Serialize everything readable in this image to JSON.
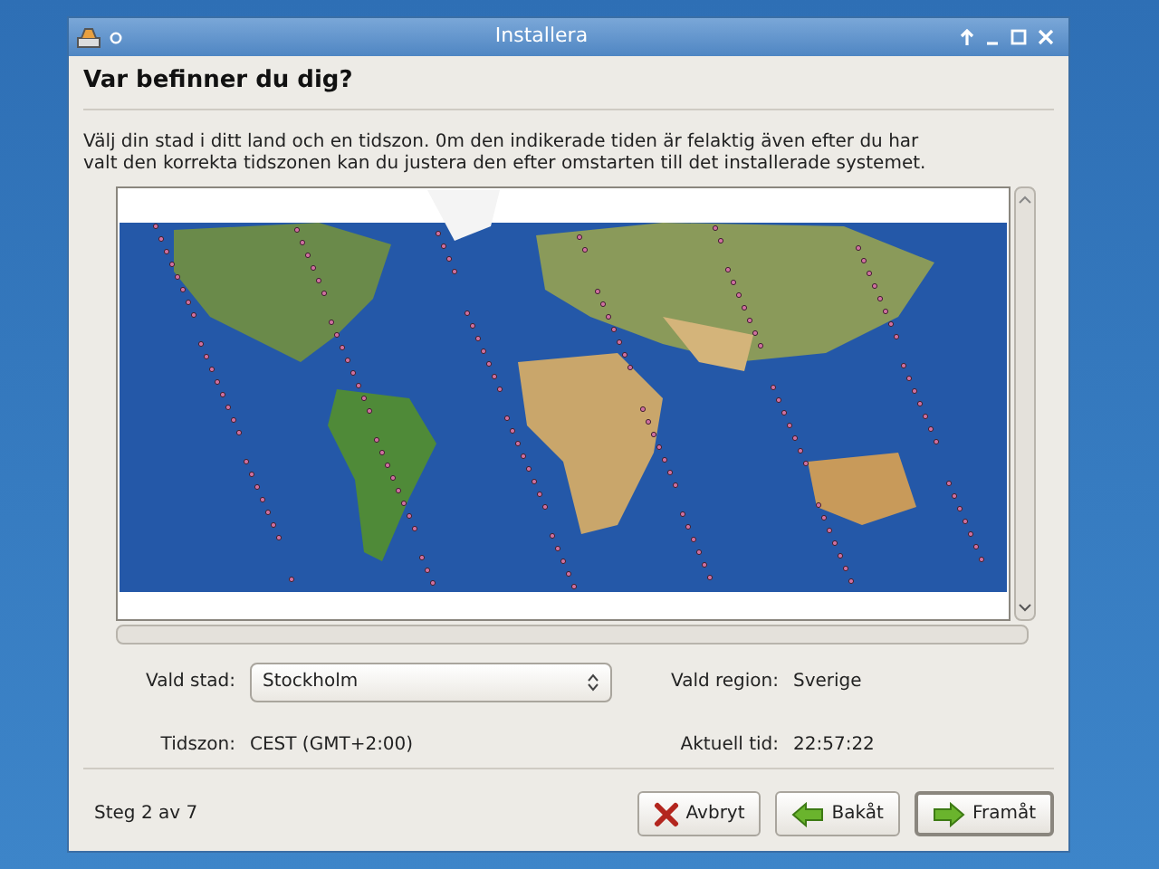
{
  "window": {
    "title": "Installera"
  },
  "heading": "Var befinner du dig?",
  "description": "Välj din stad i ditt land och en tidszon. 0m den indikerade tiden är felaktig även efter du har valt den korrekta tidszonen kan du justera den efter omstarten till det installerade systemet.",
  "form": {
    "city_label": "Vald stad:",
    "city_value": "Stockholm",
    "region_label": "Vald region:",
    "region_value": "Sverige",
    "timezone_label": "Tidszon:",
    "timezone_value": "CEST (GMT+2:00)",
    "time_label": "Aktuell tid:",
    "time_value": "22:57:22"
  },
  "step": "Steg 2 av 7",
  "buttons": [
    {
      "kind": "cancel",
      "label": "Avbryt",
      "focused": false
    },
    {
      "kind": "back",
      "label": "Bakåt",
      "focused": false
    },
    {
      "kind": "forward",
      "label": "Framåt",
      "focused": true
    }
  ]
}
